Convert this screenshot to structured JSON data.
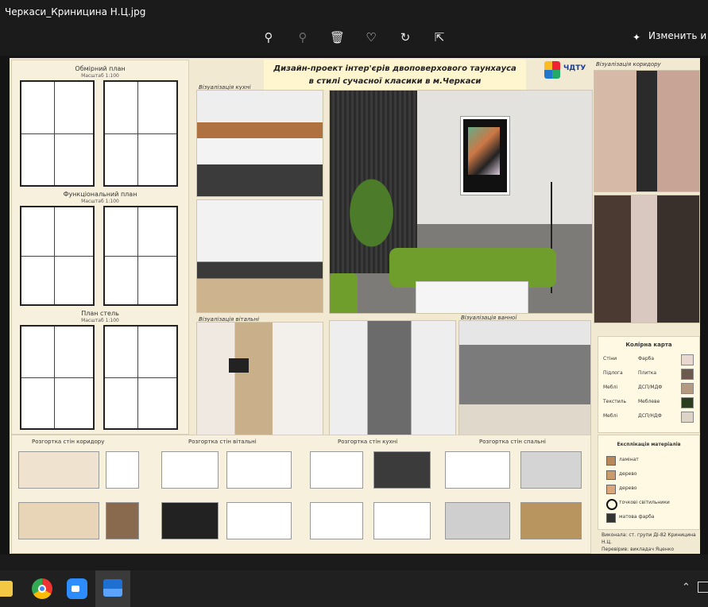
{
  "window": {
    "title": "Черкаси_Криницина Н.Ц.jpg"
  },
  "toolbar": {
    "icons": [
      "zoom-in-icon",
      "zoom-out-icon",
      "delete-icon",
      "favorite-icon",
      "rotate-icon",
      "crop-icon"
    ],
    "edit_label": "Изменить и со"
  },
  "poster": {
    "header_line1": "Дизайн-проект інтер'єрів двоповерхового таунхауса",
    "header_line2": "в стилі сучасної класики в м.Черкаси",
    "logo_text": "ЧДТУ",
    "plans": [
      {
        "title": "Обмірний план",
        "scale": "Масштаб 1:100"
      },
      {
        "title": "Функціональний план",
        "scale": "Масштаб 1:100"
      },
      {
        "title": "План стель",
        "scale": "Масштаб 1:100"
      }
    ],
    "captions": {
      "kitchen": "Візуалізація кухні",
      "dining": "Візуалізація вітальні",
      "bathroom": "Візуалізація ванної",
      "corridor": "Візуалізація коридору"
    },
    "color_card": {
      "title": "Колірна карта",
      "rows": [
        {
          "a": "Стіни",
          "b": "Фарба",
          "color": "#e8d8cf"
        },
        {
          "a": "Підлога",
          "b": "Плитка",
          "color": "#6d5a4f"
        },
        {
          "a": "Меблі",
          "b": "ДСП/МДФ",
          "color": "#b39a80"
        },
        {
          "a": "Текстиль",
          "b": "Меблеве",
          "color": "#2b3d1f"
        },
        {
          "a": "Меблі",
          "b": "ДСП/НДФ",
          "color": "#ddd3c6"
        }
      ]
    },
    "developments": [
      {
        "label": "Розгортка стін коридору"
      },
      {
        "label": "Розгортка стін вітальні"
      },
      {
        "label": "Розгортка стін кухні"
      },
      {
        "label": "Розгортка стін спальні"
      }
    ],
    "legend": {
      "title": "Експлікація матеріалів",
      "items": [
        {
          "label": "ламінат",
          "color": "#b9885a"
        },
        {
          "label": "дерево",
          "color": "#c99a6b"
        },
        {
          "label": "дерево",
          "color": "#d9a77a"
        },
        {
          "label": "точкові світильники",
          "color": "ring"
        },
        {
          "label": "матова фарба",
          "color": "#333333"
        }
      ]
    },
    "footer_line1": "Виконала: ст. групи ДІ-82 Криницина Н.Ц.",
    "footer_line2": "Перевірив: викладач Яценко Денисенко Н.Ю."
  }
}
